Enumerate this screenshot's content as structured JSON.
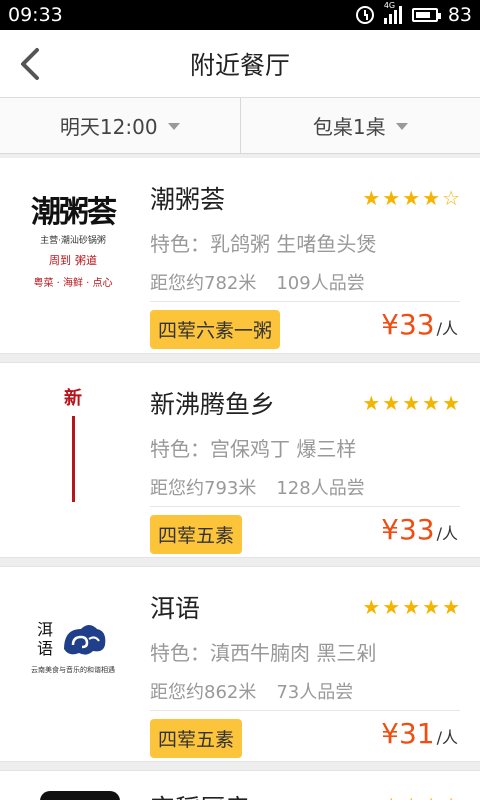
{
  "status": {
    "time": "09:33",
    "network": "4G",
    "battery": "83"
  },
  "header": {
    "title": "附近餐厅"
  },
  "filters": [
    {
      "label": "明天12:00"
    },
    {
      "label": "包桌1桌"
    }
  ],
  "restaurants": [
    {
      "name": "潮粥荟",
      "rating": 4,
      "specialty": "特色：乳鸽粥 生啫鱼头煲",
      "distance": "距您约782米",
      "reviews": "109人品尝",
      "package": "四荤六素一粥",
      "price": "¥33",
      "price_unit": "/人",
      "logo": {
        "main": "潮粥荟",
        "sub": "主营·潮汕砂锅粥",
        "red1": "周到",
        "red2": "粥道",
        "foot": "粤菜 · 海鲜 · 点心"
      }
    },
    {
      "name": "新沸腾鱼乡",
      "rating": 5,
      "specialty": "特色：宫保鸡丁 爆三样",
      "distance": "距您约793米",
      "reviews": "128人品尝",
      "package": "四荤五素",
      "price": "¥33",
      "price_unit": "/人",
      "logo": {
        "char": "新"
      }
    },
    {
      "name": "洱语",
      "rating": 5,
      "specialty": "特色：滇西牛腩肉 黑三剁",
      "distance": "距您约862米",
      "reviews": "73人品尝",
      "package": "四荤五素",
      "price": "¥31",
      "price_unit": "/人",
      "logo": {
        "c1": "洱",
        "c2": "语",
        "foot": "云南美食与音乐的和谐相遇"
      }
    }
  ],
  "partial": {
    "name": "宫稻厨房"
  },
  "colors": {
    "accent": "#fcc43b",
    "price": "#f04d12",
    "star": "#f5b400"
  }
}
